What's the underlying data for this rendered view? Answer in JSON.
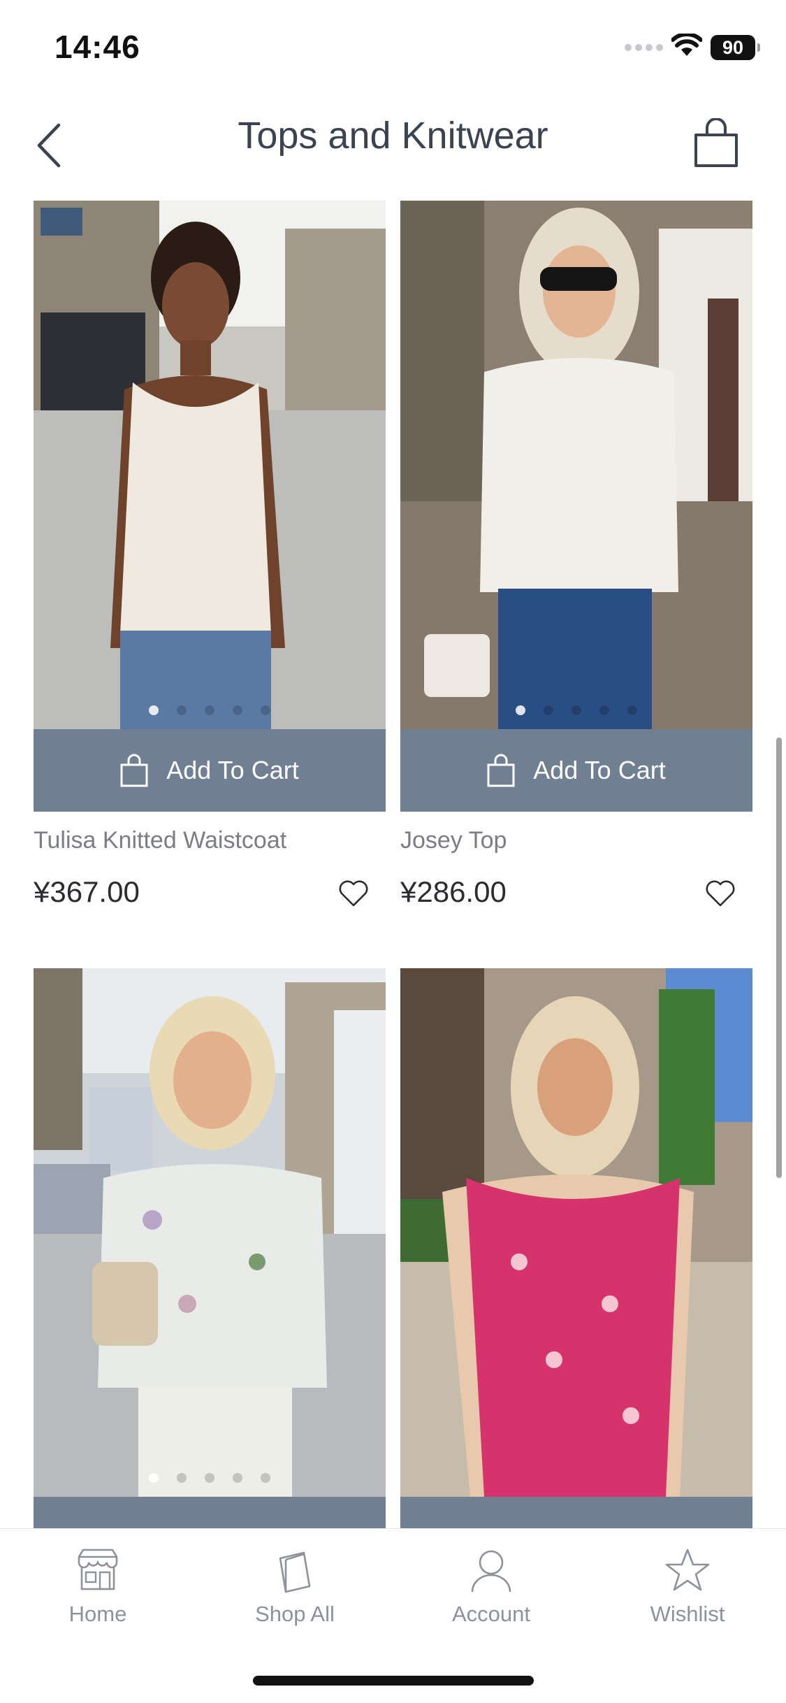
{
  "status": {
    "time": "14:46",
    "battery": "90"
  },
  "header": {
    "title": "Tops and Knitwear",
    "back_icon": "chevron-left-icon",
    "cart_icon": "shopping-bag-icon"
  },
  "products": [
    {
      "name": "Tulisa Knitted Waistcoat",
      "price": "¥367.00",
      "add_to_cart": "Add To Cart",
      "image_count": 5
    },
    {
      "name": "Josey Top",
      "price": "¥286.00",
      "add_to_cart": "Add To Cart",
      "image_count": 5
    },
    {
      "image_count": 5
    },
    {
      "image_count": 1
    }
  ],
  "tab_bar": [
    {
      "label": "Home",
      "icon": "storefront-icon"
    },
    {
      "label": "Shop All",
      "icon": "shopping-bag-icon"
    },
    {
      "label": "Account",
      "icon": "person-icon"
    },
    {
      "label": "Wishlist",
      "icon": "star-icon"
    }
  ],
  "colors": {
    "accent": "#717f93",
    "title": "#3b4250",
    "muted": "#8d9299"
  }
}
